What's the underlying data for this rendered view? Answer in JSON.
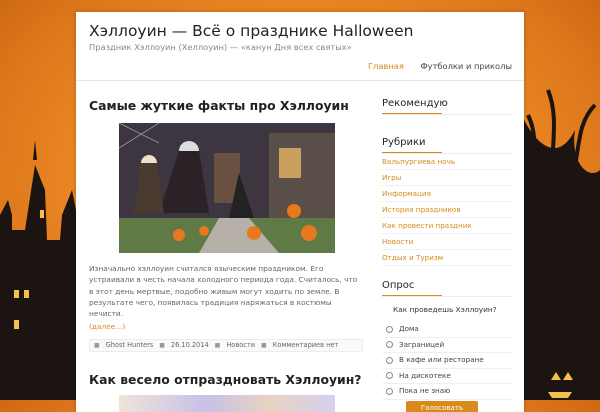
{
  "site": {
    "title": "Хэллоуин — Всё о празднике Halloween",
    "description": "Праздник Хэллоуин (Хеллоуин) — «канун Дня всех святых»"
  },
  "nav": {
    "items": [
      "Главная",
      "Футболки и приколы"
    ],
    "active_index": 0
  },
  "posts": [
    {
      "title": "Самые жуткие факты про Хэллоуин",
      "excerpt": "Изначально хэллоуин считался языческим праздником. Его устраивали в честь начала холодного периода года. Считалось, что в этот день мертвые, подобно живым могут ходить по земле. В результате чего, появилась традиция наряжаться в костюмы нечисти.",
      "more": "(далее...)",
      "author": "Ghost Hunters",
      "date": "26.10.2014",
      "category": "Новости",
      "comments": "Комментариев нет"
    },
    {
      "title": "Как весело отпраздновать Хэллоуин?"
    }
  ],
  "sidebar": {
    "recommend_title": "Рекомендую",
    "rubrics_title": "Рубрики",
    "rubrics": [
      "Вальпургиева ночь",
      "Игры",
      "Информация",
      "История праздников",
      "Как провести праздник",
      "Новости",
      "Отдых и Туризм"
    ],
    "poll_title": "Опрос",
    "poll_question": "Как проведешь Хэллоуин?",
    "poll_options": [
      "Дома",
      "Заграницей",
      "В кафе или ресторане",
      "На дискотеке",
      "Пока не знаю"
    ],
    "vote_label": "Голосовать"
  },
  "colors": {
    "accent": "#d98a1c",
    "background": "#ef8c25"
  },
  "icons": [
    "author-icon",
    "calendar-icon",
    "folder-icon",
    "comment-icon"
  ]
}
